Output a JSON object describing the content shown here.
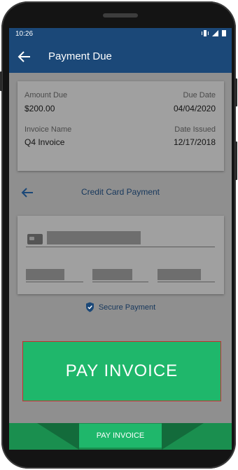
{
  "status_bar": {
    "time": "10:26"
  },
  "app_bar": {
    "title": "Payment Due"
  },
  "invoice": {
    "amount_label": "Amount Due",
    "amount_value": "$200.00",
    "due_label": "Due Date",
    "due_value": "04/04/2020",
    "name_label": "Invoice Name",
    "name_value": "Q4 Invoice",
    "issued_label": "Date Issued",
    "issued_value": "12/17/2018"
  },
  "payment": {
    "title": "Credit Card Payment",
    "secure_label": "Secure Payment"
  },
  "buttons": {
    "pay_big": "PAY INVOICE",
    "pay_small": "PAY INVOICE"
  },
  "colors": {
    "app_bar": "#1b4878",
    "overlay": "#8f8f8f",
    "accent_green": "#1fb76b",
    "dark_green": "#1a8f4f",
    "highlight_border": "#c72f2f"
  },
  "icons": {
    "back": "arrow-left-icon",
    "card": "credit-card-icon",
    "secure": "shield-check-icon"
  }
}
